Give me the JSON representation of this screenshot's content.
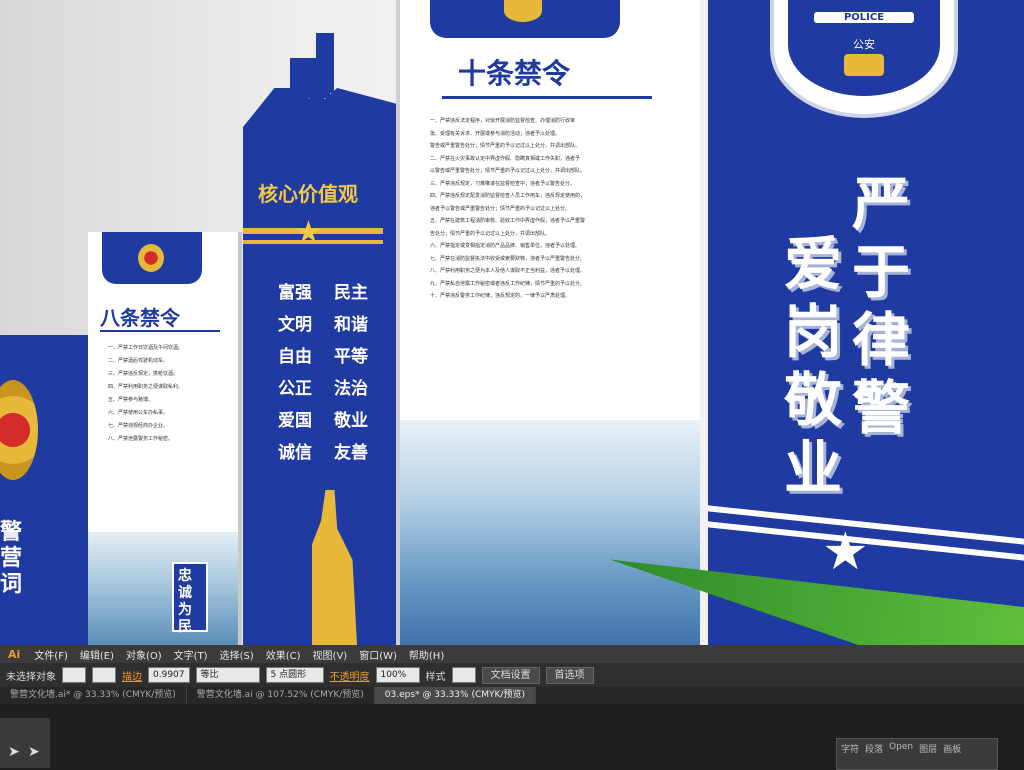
{
  "app": {
    "logo": "Ai"
  },
  "artwork": {
    "left_panel_title": "八条禁令",
    "left_panel_lines": [
      "一、严禁工作日饮酒及午间饮酒。",
      "二、严禁酒后驾驶机动车。",
      "三、严禁违反规定，携枪饮酒。",
      "四、严禁利用职务之便谋取私利。",
      "五、严禁参与赌博。",
      "六、严禁使用公车办私事。",
      "七、严禁违规经商办企业。",
      "八、严禁泄露警务工作秘密。"
    ],
    "left_panel_badge": "忠诚为民",
    "left_edge_text": "警营词",
    "core_title": "核心价值观",
    "core_values": [
      [
        "富强",
        "民主"
      ],
      [
        "文明",
        "和谐"
      ],
      [
        "自由",
        "平等"
      ],
      [
        "公正",
        "法治"
      ],
      [
        "爱国",
        "敬业"
      ],
      [
        "诚信",
        "友善"
      ]
    ],
    "ten_title": "十条禁令",
    "ten_lines": [
      "一、严禁违反法定程序，对饭开展消防监督检查、办理消防行政审",
      "批、受理有关诉求、开展或参与消防活动；违者予以处理。",
      "警告或严重警告处分；情节严重的予以记过以上处分，并调出部队。",
      "二、严禁在火灾事故认定中弄虚作假、隐瞒真相或工作失职，违者予",
      "以警告或严重警告处分；情节严重的予以记过以上处分，并调出部队。",
      "三、严禁违反规定，刁难推诿在监督检查中；违者予以警告处分。",
      "四、严禁违反规定配发消防监督检查人员工作用车；违反规定使用的，",
      "违者予以警告或严重警告处分；情节严重的予以记过以上处分。",
      "五、严禁在建筑工程消防审核、验收工作中弄虚作假，违者予以严重警",
      "告处分；情节严重的予以记过以上处分，并调出部队。",
      "六、严禁指定或变相指定消防产品品牌、销售单位，违者予以处理。",
      "七、严禁在消防监督执法中收受或索要财物，违者予以严重警告处分。",
      "八、严禁利用职务之便为本人及他人谋取不正当利益，违者予以处理。",
      "九、严禁私自泄露工作秘密或者违反工作纪律，情节严重的予以处分。",
      "十、严禁违反警务工作纪律，违反规定的，一律予以严肃处理。"
    ],
    "police_label": "POLICE",
    "badge_text": "公安",
    "right_slogan_1": "严于律警",
    "right_slogan_2": "爱岗敬业"
  },
  "menu": [
    "文件(F)",
    "编辑(E)",
    "对象(O)",
    "文字(T)",
    "选择(S)",
    "效果(C)",
    "视图(V)",
    "窗口(W)",
    "帮助(H)"
  ],
  "control_bar": {
    "no_selection": "未选择对象",
    "stroke_label": "描边",
    "stroke_value": "0.9907",
    "stroke_profile": "等比",
    "brush": "5 点圆形",
    "opacity_label": "不透明度",
    "opacity_value": "100%",
    "style_label": "样式",
    "doc_setup": "文档设置",
    "prefs": "首选项"
  },
  "tabs": [
    {
      "label": "警营文化墙.ai* @ 33.33% (CMYK/预览)",
      "active": false
    },
    {
      "label": "警营文化墙.ai @ 107.52% (CMYK/预览)",
      "active": false
    },
    {
      "label": "03.eps* @ 33.33% (CMYK/预览)",
      "active": true
    }
  ],
  "panels": {
    "tabs": [
      "字符",
      "段落",
      "Open",
      "图层",
      "画板"
    ]
  },
  "colors": {
    "brand_blue": "#1e3a9e",
    "gold": "#e8b83a",
    "ui_dark": "#2f2f2f"
  }
}
